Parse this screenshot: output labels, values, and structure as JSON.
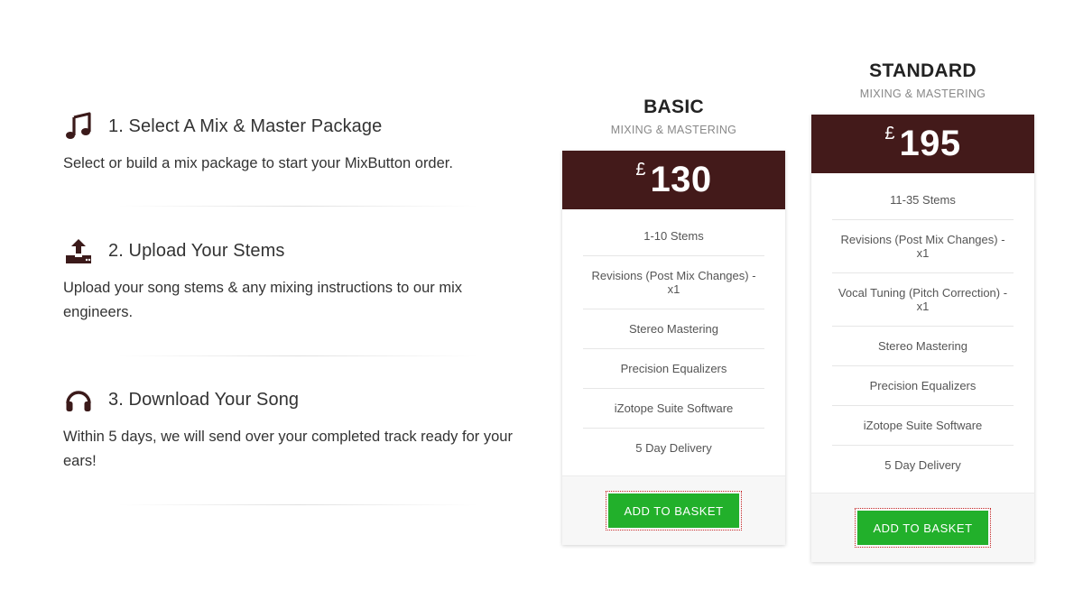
{
  "steps": [
    {
      "icon": "music-note-icon",
      "title": "1. Select A Mix & Master Package",
      "description": "Select or build a mix package to start your MixButton order."
    },
    {
      "icon": "upload-icon",
      "title": "2. Upload Your Stems",
      "description": "Upload your song stems & any mixing instructions to our mix engineers."
    },
    {
      "icon": "headphones-icon",
      "title": "3. Download Your Song",
      "description": "Within 5 days, we will send over your completed track ready for your ears!"
    }
  ],
  "plans": {
    "basic": {
      "name": "BASIC",
      "subtitle": "MIXING & MASTERING",
      "currency": "£",
      "price": "130",
      "features": [
        "1-10 Stems",
        "Revisions (Post Mix Changes) - x1",
        "Stereo Mastering",
        "Precision Equalizers",
        "iZotope Suite Software",
        "5 Day Delivery"
      ],
      "button_label": "ADD TO BASKET"
    },
    "standard": {
      "name": "STANDARD",
      "subtitle": "MIXING & MASTERING",
      "currency": "£",
      "price": "195",
      "features": [
        "11-35 Stems",
        "Revisions (Post Mix Changes) - x1",
        "Vocal Tuning (Pitch Correction) - x1",
        "Stereo Mastering",
        "Precision Equalizers",
        "iZotope Suite Software",
        "5 Day Delivery"
      ],
      "button_label": "ADD TO BASKET"
    }
  },
  "colors": {
    "price_band": "#431a1a",
    "button": "#22b02b",
    "icon": "#3b1a1a"
  }
}
